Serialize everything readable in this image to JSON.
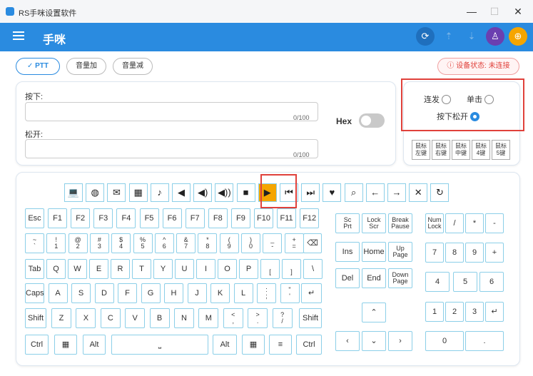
{
  "window": {
    "title": "RS手咪设置软件",
    "minimize": "—",
    "maximize": "☐",
    "close": "✕"
  },
  "header": {
    "title": "手咪",
    "icons": [
      "refresh-icon",
      "upload-icon",
      "download-icon",
      "brush-icon",
      "globe-icon"
    ]
  },
  "toolbar": {
    "ptt": "PTT",
    "vol_up": "音量加",
    "vol_down": "音量减",
    "status": "设备状态: 未连接"
  },
  "form": {
    "press_label": "按下:",
    "press_value": "",
    "press_counter": "0/100",
    "release_label": "松开:",
    "release_value": "",
    "release_counter": "0/100",
    "hex_label": "Hex"
  },
  "modes": {
    "continuous": "连发",
    "single": "单击",
    "press_release": "按下松开",
    "selected": "按下松开"
  },
  "mouse": [
    [
      "鼠标",
      "左键"
    ],
    [
      "鼠标",
      "右键"
    ],
    [
      "鼠标",
      "中键"
    ],
    [
      "鼠标",
      "4键"
    ],
    [
      "鼠标",
      "5键"
    ]
  ],
  "media_icons": [
    "laptop",
    "globe",
    "mail",
    "calculator",
    "music",
    "vol-mute",
    "vol-down",
    "vol-up",
    "stop",
    "play",
    "prev",
    "next",
    "heart",
    "search",
    "arrow-left",
    "arrow-right",
    "close",
    "refresh"
  ],
  "keys": {
    "row1": [
      "Esc",
      "F1",
      "F2",
      "F3",
      "F4",
      "F5",
      "F6",
      "F7",
      "F8",
      "F9",
      "F10",
      "F11",
      "F12"
    ],
    "row2": [
      [
        "~",
        "`"
      ],
      [
        "!",
        "1"
      ],
      [
        "@",
        "2"
      ],
      [
        "#",
        "3"
      ],
      [
        "$",
        "4"
      ],
      [
        "%",
        "5"
      ],
      [
        "^",
        "6"
      ],
      [
        "&",
        "7"
      ],
      [
        "*",
        "8"
      ],
      [
        "(",
        "9"
      ],
      [
        ")",
        "0"
      ],
      [
        "_",
        "-"
      ],
      [
        "+",
        "="
      ]
    ],
    "row3": [
      "Tab",
      "Q",
      "W",
      "E",
      "R",
      "T",
      "Y",
      "U",
      "I",
      "O",
      "P",
      [
        "",
        "["
      ],
      [
        "",
        "]"
      ],
      "\\"
    ],
    "row4": [
      "Caps",
      "A",
      "S",
      "D",
      "F",
      "G",
      "H",
      "J",
      "K",
      "L",
      [
        ":",
        ";"
      ],
      [
        "\"",
        "'"
      ]
    ],
    "row5": [
      "Shift",
      "Z",
      "X",
      "C",
      "V",
      "B",
      "N",
      "M",
      [
        "<",
        ","
      ],
      [
        ">",
        "."
      ],
      [
        "?",
        "/"
      ],
      "Shift"
    ],
    "row6": [
      "Ctrl",
      "Alt",
      "Alt",
      "Ctrl"
    ],
    "nav1": [
      [
        "Sc",
        "Prt"
      ],
      [
        "Lock",
        "Scr"
      ],
      [
        "Break",
        "Pause"
      ]
    ],
    "nav2": [
      "Ins",
      "Home",
      [
        "Up",
        "Page"
      ]
    ],
    "nav3": [
      "Del",
      "End",
      [
        "Down",
        "Page"
      ]
    ],
    "num1": [
      [
        "Num",
        "Lock"
      ],
      "/",
      "*",
      "-"
    ],
    "num2": [
      "7",
      "8",
      "9",
      "+"
    ],
    "num3": [
      "4",
      "5",
      "6"
    ],
    "num4": [
      "1",
      "2",
      "3"
    ],
    "num5": [
      "0",
      "."
    ]
  },
  "colors": {
    "accent": "#2a8be0",
    "highlight": "#e0413b",
    "play": "#f5a500"
  }
}
